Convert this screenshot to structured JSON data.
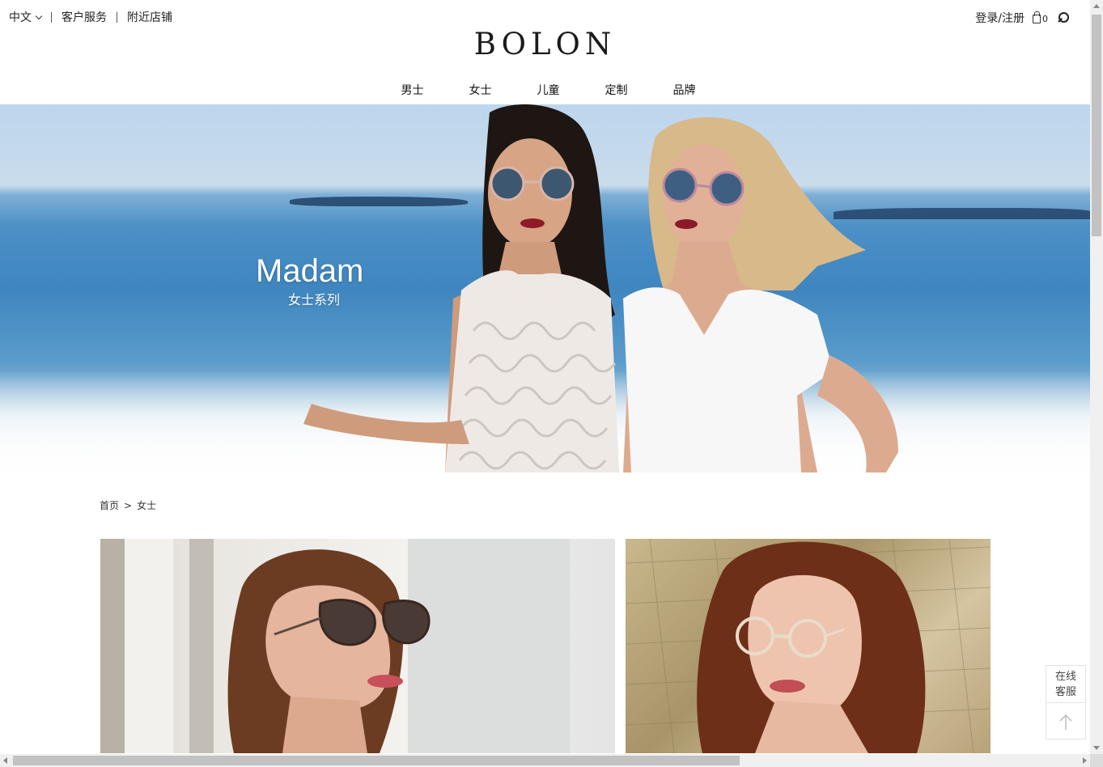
{
  "header": {
    "language": "中文",
    "customer_service": "客户服务",
    "nearby_stores": "附近店铺",
    "login_register": "登录/注册",
    "cart_count": "0",
    "logo": "BOLON"
  },
  "nav": {
    "items": [
      {
        "label": "男士"
      },
      {
        "label": "女士"
      },
      {
        "label": "儿童"
      },
      {
        "label": "定制"
      },
      {
        "label": "品牌"
      }
    ]
  },
  "hero": {
    "title": "Madam",
    "subtitle": "女士系列"
  },
  "breadcrumb": {
    "home": "首页",
    "separator": ">",
    "current": "女士"
  },
  "float_widget": {
    "service_line1": "在线",
    "service_line2": "客服",
    "back_to_top_icon": "arrow-up-icon"
  },
  "colors": {
    "text": "#222222",
    "background": "#ffffff",
    "sea": "#3f86c0"
  }
}
